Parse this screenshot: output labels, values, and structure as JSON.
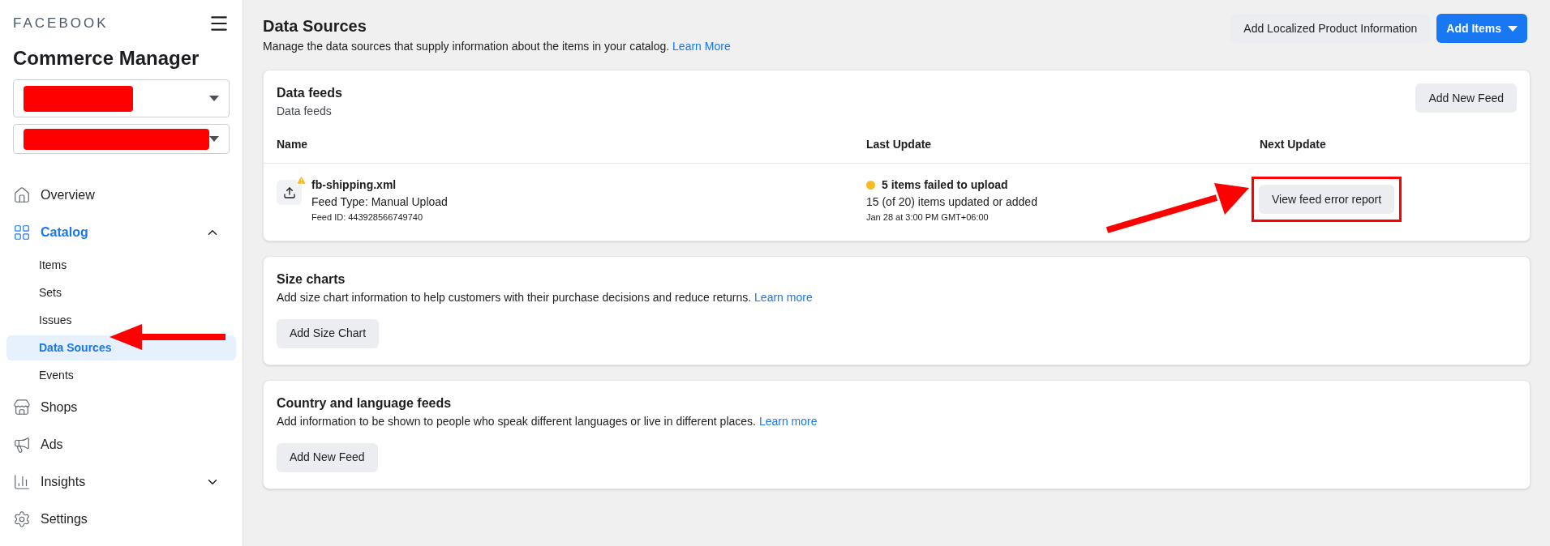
{
  "sidebar": {
    "brand": "FACEBOOK",
    "title": "Commerce Manager",
    "nav": [
      {
        "label": "Overview",
        "selected": false
      },
      {
        "label": "Catalog",
        "selected": true,
        "expanded": true,
        "children": [
          {
            "label": "Items",
            "selected": false
          },
          {
            "label": "Sets",
            "selected": false
          },
          {
            "label": "Issues",
            "selected": false
          },
          {
            "label": "Data Sources",
            "selected": true
          },
          {
            "label": "Events",
            "selected": false
          }
        ]
      },
      {
        "label": "Shops",
        "selected": false
      },
      {
        "label": "Ads",
        "selected": false
      },
      {
        "label": "Insights",
        "selected": false,
        "expanded": false
      },
      {
        "label": "Settings",
        "selected": false
      }
    ]
  },
  "header": {
    "title": "Data Sources",
    "description": "Manage the data sources that supply information about the items in your catalog.",
    "link": "Learn More",
    "buttons": [
      {
        "label": "Add Localized Product Information",
        "kind": "secondary"
      },
      {
        "label": "Add Items",
        "kind": "primary"
      }
    ]
  },
  "data_feeds": {
    "title": "Data feeds",
    "subtitle": "Data feeds",
    "button": "Add New Feed",
    "columns": [
      "Name",
      "Last Update",
      "Next Update"
    ],
    "rows": [
      {
        "name": "fb-shipping.xml",
        "feed_type": "Feed Type: Manual Upload",
        "feed_id": "Feed ID: 443928566749740",
        "status": "5 items failed to upload",
        "color": "#f7b928",
        "counts": "15 (of 20) items updated or added",
        "time": "Jan 28 at 3:00 PM GMT+06:00",
        "action": "View feed error report"
      }
    ]
  },
  "cards": [
    {
      "title": "Size charts",
      "description": "Add size chart information to help customers with their purchase decisions and reduce returns.",
      "link": "Learn more",
      "button": "Add Size Chart"
    },
    {
      "title": "Country and language feeds",
      "description": "Add information to be shown to people who speak different languages or live in different places.",
      "link": "Learn more",
      "button": "Add New Feed"
    }
  ]
}
